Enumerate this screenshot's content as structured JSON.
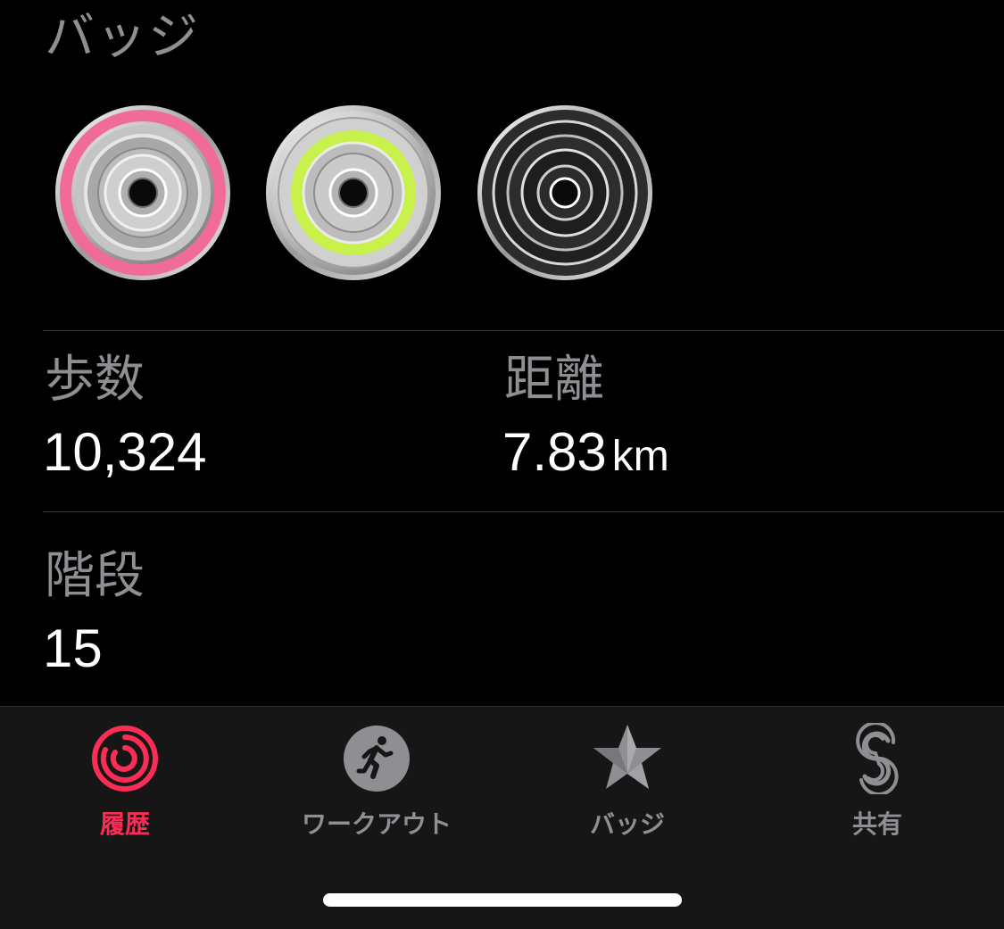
{
  "badges_section": {
    "title": "バッジ",
    "items": [
      {
        "name": "move-badge",
        "accent": "#f06b97"
      },
      {
        "name": "exercise-badge",
        "accent": "#c8f24b"
      },
      {
        "name": "stand-badge",
        "accent": "#2a2c2e"
      }
    ]
  },
  "stats": {
    "steps": {
      "label": "歩数",
      "value": "10,324"
    },
    "distance": {
      "label": "距離",
      "value": "7.83",
      "unit": "km"
    },
    "flights": {
      "label": "階段",
      "value": "15"
    }
  },
  "tabbar": {
    "tabs": [
      {
        "label": "履歴",
        "icon": "activity-rings-icon",
        "active": true
      },
      {
        "label": "ワークアウト",
        "icon": "running-figure-icon",
        "active": false
      },
      {
        "label": "バッジ",
        "icon": "star-award-icon",
        "active": false
      },
      {
        "label": "共有",
        "icon": "sharing-s-icon",
        "active": false
      }
    ]
  },
  "colors": {
    "accent_active": "#fa2d55",
    "inactive": "#8e8e93",
    "background": "#000000",
    "tabbar_background": "#161616"
  }
}
